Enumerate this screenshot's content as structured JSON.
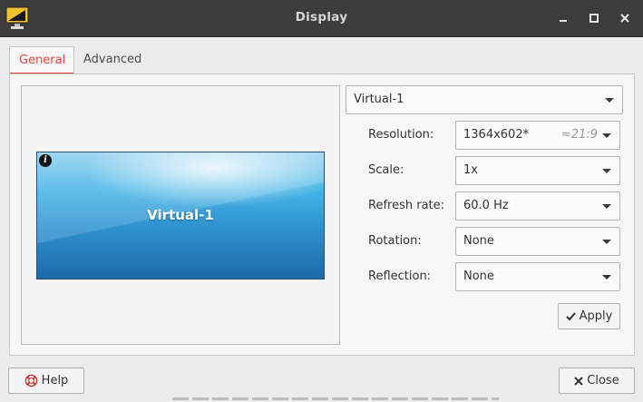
{
  "window": {
    "title": "Display",
    "controls": {
      "minimize": "minimize-icon",
      "maximize": "maximize-icon",
      "close": "close-icon"
    }
  },
  "tabs": [
    {
      "label": "General",
      "active": true
    },
    {
      "label": "Advanced",
      "active": false
    }
  ],
  "preview": {
    "monitor_label": "Virtual-1",
    "info_glyph": "i"
  },
  "display_select": {
    "value": "Virtual-1"
  },
  "settings": {
    "resolution": {
      "label": "Resolution:",
      "value": "1364x602*",
      "aspect_hint": "≈21:9"
    },
    "scale": {
      "label": "Scale:",
      "value": "1x"
    },
    "refresh_rate": {
      "label": "Refresh rate:",
      "value": "60.0 Hz"
    },
    "rotation": {
      "label": "Rotation:",
      "value": "None"
    },
    "reflection": {
      "label": "Reflection:",
      "value": "None"
    }
  },
  "buttons": {
    "apply": "Apply",
    "help": "Help",
    "close": "Close"
  },
  "colors": {
    "accent": "#e0443a",
    "titlebar": "#3c3c3c",
    "monitor_top": "#8fd0ee",
    "monitor_bottom": "#1e6aa9"
  }
}
